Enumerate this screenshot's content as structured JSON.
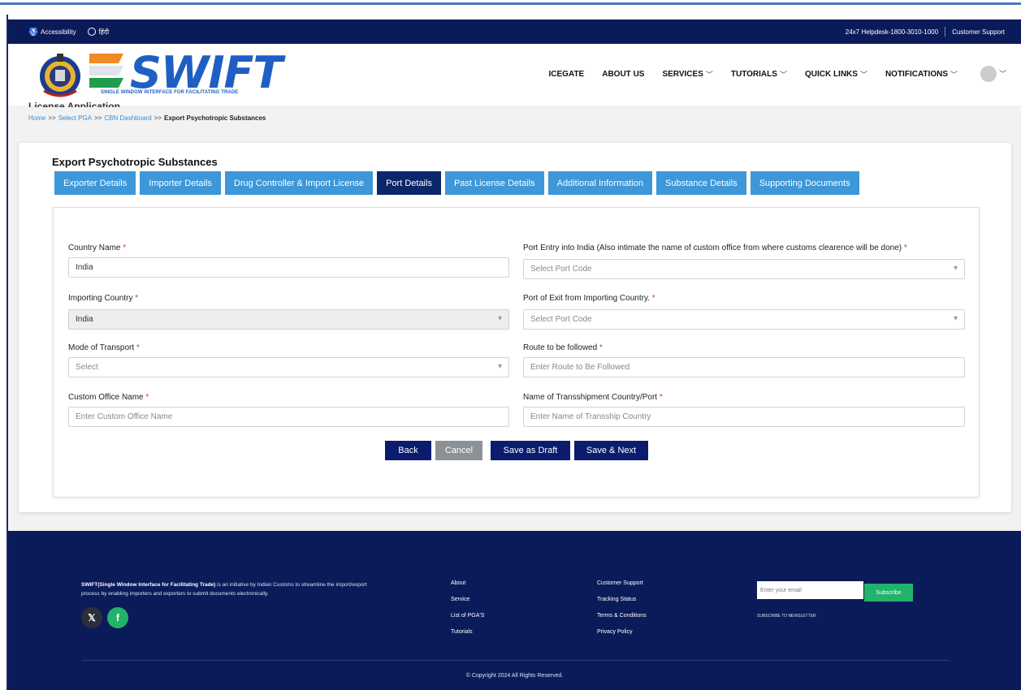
{
  "topbar": {
    "accessibility": "Accessibility",
    "language": "हिंदी",
    "helpdesk": "24x7 Helpdesk-1800-3010-1000",
    "support": "Customer Support"
  },
  "header": {
    "logo_text": "SWIFT",
    "logo_subtitle": "SINGLE WINDOW INTERFACE FOR FACILITATING TRADE",
    "nav": [
      "ICEGATE",
      "ABOUT US",
      "SERVICES",
      "TUTORIALS",
      "QUICK LINKS",
      "NOTIFICATIONS"
    ]
  },
  "page": {
    "title": "License Application",
    "breadcrumb": [
      "Home",
      "Select PGA",
      "CBN Dashboard",
      "Export Psychotropic Substances"
    ],
    "card_title": "Export Psychotropic Substances"
  },
  "tabs": [
    "Exporter Details",
    "Importer Details",
    "Drug Controller & Import License",
    "Port Details",
    "Past License Details",
    "Additional Information",
    "Substance Details",
    "Supporting Documents"
  ],
  "active_tab": "Port Details",
  "form": {
    "country_name": {
      "label": "Country Name",
      "value": "India"
    },
    "port_entry": {
      "label": "Port Entry into India (Also intimate the name of custom office from where customs clearence will be done)",
      "placeholder": "Select Port Code"
    },
    "importing_country": {
      "label": "Importing Country",
      "value": "India"
    },
    "port_exit": {
      "label": "Port of Exit from Importing Country.",
      "placeholder": "Select Port Code"
    },
    "mode_transport": {
      "label": "Mode of Transport",
      "placeholder": "Select"
    },
    "route": {
      "label": "Route to be followed",
      "placeholder": "Enter Route to Be Followed"
    },
    "custom_office": {
      "label": "Custom Office Name",
      "placeholder": "Enter Custom Office Name"
    },
    "transshipment": {
      "label": "Name of Transshipment Country/Port",
      "placeholder": "Enter Name of Transship Country"
    },
    "required_mark": "*"
  },
  "buttons": {
    "back": "Back",
    "cancel": "Cancel",
    "draft": "Save as Draft",
    "next": "Save & Next"
  },
  "footer": {
    "about_bold": "SWIFT(Single Window Interface for Facilitating Trade)",
    "about_rest": " is an initiative by Indian Customs to streamline the import/export process by enabling importers and exporters to submit documents electronically.",
    "col1": [
      "About",
      "Service",
      "List of PGA'S",
      "Tutorials"
    ],
    "col2": [
      "Customer Support",
      "Tracking Status",
      "Terms & Conditions",
      "Privacy Policy"
    ],
    "email_placeholder": "Enter your email",
    "subscribe": "Subscribe",
    "newsletter": "SUBSCRIBE TO NEWSLETTER",
    "copyright": "© Copyright 2024 All Rights Reserved."
  },
  "colors": {
    "navy": "#0b1b5a",
    "tab_blue": "#3d97d8",
    "tab_active": "#0b2669",
    "brand_blue": "#1f5fc4",
    "green": "#22b36a"
  }
}
